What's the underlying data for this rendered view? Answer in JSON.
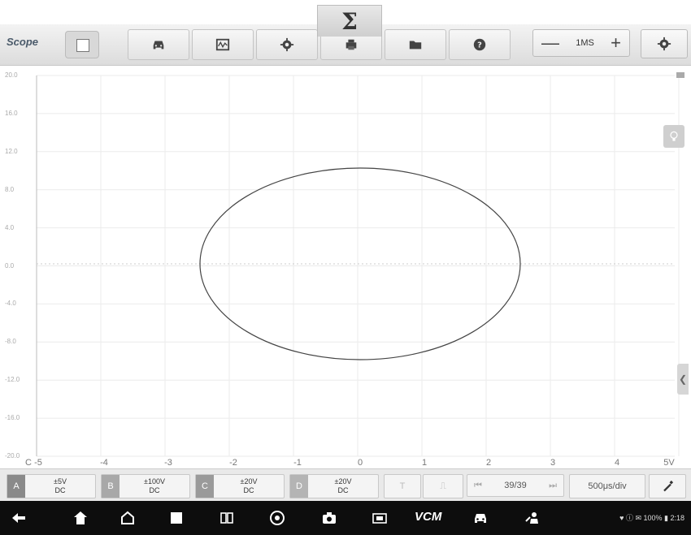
{
  "app": {
    "brand": "Scope"
  },
  "toolbar": {
    "sigma": "Σ",
    "timebase": {
      "minus": "—",
      "value": "1MS",
      "plus": "+"
    }
  },
  "plot": {
    "y_labels": [
      "20.0",
      "16.0",
      "12.0",
      "8.0",
      "4.0",
      "0.0",
      "-4.0",
      "-8.0",
      "-12.0",
      "-16.0",
      "-20.0"
    ],
    "x_labels": [
      "C",
      "-5",
      "-4",
      "-3",
      "-2",
      "-1",
      "0",
      "1",
      "2",
      "3",
      "4",
      "5V"
    ],
    "trace_color": "#444444"
  },
  "channels": [
    {
      "letter": "A",
      "range": "±5V",
      "coupling": "DC",
      "color": "#8a8a8a"
    },
    {
      "letter": "B",
      "range": "±100V",
      "coupling": "DC",
      "color": "#a8a8a8"
    },
    {
      "letter": "C",
      "range": "±20V",
      "coupling": "DC",
      "color": "#9a9a9a"
    },
    {
      "letter": "D",
      "range": "±20V",
      "coupling": "DC",
      "color": "#b4b4b4"
    }
  ],
  "controls": {
    "trigger": "T",
    "pulse": "⎍",
    "prev": "⏮",
    "page": "39/39",
    "next": "⏭",
    "timediv": "500μs/div"
  },
  "status": {
    "text": "♥ ⓘ ✉ 100% ▮ 2:18"
  },
  "navbar": {
    "vcm": "VCM"
  }
}
